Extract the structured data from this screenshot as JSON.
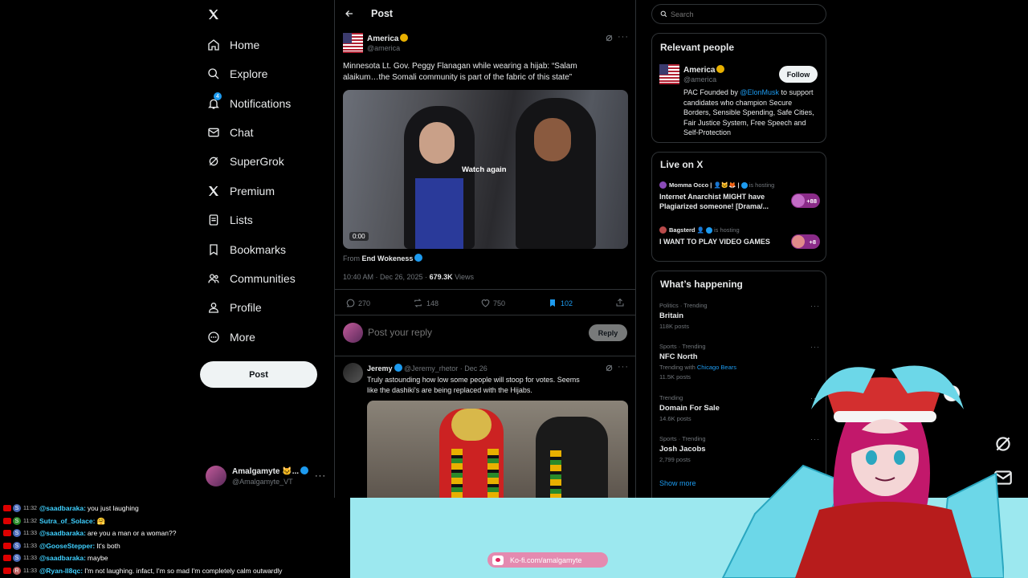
{
  "nav": {
    "items": [
      {
        "label": "Home",
        "icon": "home-icon"
      },
      {
        "label": "Explore",
        "icon": "search-icon"
      },
      {
        "label": "Notifications",
        "icon": "bell-icon",
        "badge": "4"
      },
      {
        "label": "Chat",
        "icon": "mail-icon"
      },
      {
        "label": "SuperGrok",
        "icon": "grok-icon"
      },
      {
        "label": "Premium",
        "icon": "x-logo-icon"
      },
      {
        "label": "Lists",
        "icon": "list-icon"
      },
      {
        "label": "Bookmarks",
        "icon": "bookmark-icon"
      },
      {
        "label": "Communities",
        "icon": "people-icon"
      },
      {
        "label": "Profile",
        "icon": "person-icon"
      },
      {
        "label": "More",
        "icon": "more-circle-icon"
      }
    ],
    "post_label": "Post",
    "account": {
      "name": "Amalgamyte 🐱...",
      "handle": "@Amalgamyte_VT"
    }
  },
  "header": {
    "title": "Post"
  },
  "post": {
    "author": "America",
    "handle": "@america",
    "text": "Minnesota Lt. Gov. Peggy Flanagan while wearing a hijab: “Salam alaikum…the Somali community is part of the fabric of this state”",
    "video_overlay": "Watch again",
    "video_time": "0:00",
    "from_label": "From",
    "from_name": "End Wokeness",
    "time": "10:40 AM · Dec 26, 2025 · ",
    "views_count": "679.3K",
    "views_label": "Views",
    "stats": {
      "replies": "270",
      "reposts": "148",
      "likes": "750",
      "bookmarks": "102"
    },
    "reply_placeholder": "Post your reply",
    "reply_button": "Reply"
  },
  "reply": {
    "author": "Jeremy",
    "handle": "@Jeremy_rhetor · Dec 26",
    "text": "Truly astounding how low some people will stoop for votes. Seems like the dashiki's are being replaced with the Hijabs."
  },
  "search": {
    "placeholder": "Search"
  },
  "relevant": {
    "title": "Relevant people",
    "name": "America",
    "handle": "@america",
    "follow": "Follow",
    "bio_prefix": "PAC Founded by ",
    "bio_mention": "@ElonMusk",
    "bio_rest": " to support candidates who champion Secure Borders, Sensible Spending, Safe Cities, Fair Justice System, Free Speech and Self-Protection"
  },
  "live": {
    "title": "Live on X",
    "items": [
      {
        "host": "Momma Occo | 👤🐱🦊 |",
        "status": "is hosting",
        "title": "Internet Anarchist MIGHT have Plagiarized someone! [Drama/...",
        "count": "+88"
      },
      {
        "host": "Bagsterd 👤",
        "status": "is hosting",
        "title": "I WANT TO PLAY VIDEO GAMES",
        "count": "+8"
      }
    ]
  },
  "happening": {
    "title": "What’s happening",
    "items": [
      {
        "context": "Politics · Trending",
        "topic": "Britain",
        "posts": "118K posts",
        "extra": ""
      },
      {
        "context": "Sports · Trending",
        "topic": "NFC North",
        "posts": "11.5K posts",
        "extra": "Trending with ",
        "extra_link": "Chicago Bears"
      },
      {
        "context": "Trending",
        "topic": "Domain For Sale",
        "posts": "14.6K posts",
        "extra": ""
      },
      {
        "context": "Sports · Trending",
        "topic": "Josh Jacobs",
        "posts": "2,799 posts",
        "extra": ""
      }
    ],
    "show_more": "Show more"
  },
  "chat": [
    {
      "badge": "S",
      "time": "11:32",
      "user": "@saadbaraka:",
      "msg": "you just laughing"
    },
    {
      "badge": "S",
      "time": "11:32",
      "user": "Sutra_of_Solace:",
      "msg": "🤗"
    },
    {
      "badge": "S",
      "time": "11:33",
      "user": "@saadbaraka:",
      "msg": "are you a man or a woman??"
    },
    {
      "badge": "S",
      "time": "11:33",
      "user": "@GooseStepper:",
      "msg": "It's both"
    },
    {
      "badge": "S",
      "time": "11:33",
      "user": "@saadbaraka:",
      "msg": "maybe"
    },
    {
      "badge": "R",
      "time": "11:33",
      "user": "@Ryan-lI8qc:",
      "msg": "I'm not laughing. infact, I'm so mad I'm completely calm outwardly"
    }
  ],
  "kofi": "Ko-fi.com/amalgamyte",
  "colors": {
    "accent": "#1d9bf0",
    "bg": "#000000",
    "border": "#2f3336",
    "muted": "#71767b",
    "stream_bg": "#9ce8ef"
  }
}
